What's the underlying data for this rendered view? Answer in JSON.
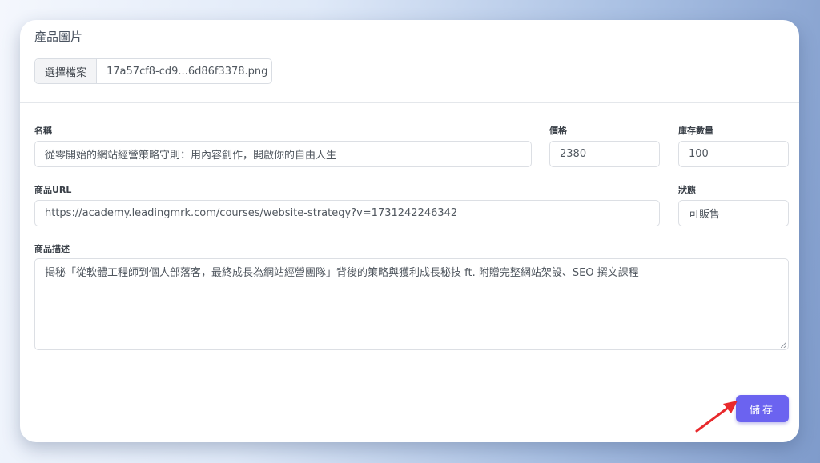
{
  "section_title": "產品圖片",
  "file_picker": {
    "button_label": "選擇檔案",
    "file_name": "17a57cf8-cd9...6d86f3378.png"
  },
  "form": {
    "name": {
      "label": "名稱",
      "value": "從零開始的網站經營策略守則：用內容創作，開啟你的自由人生"
    },
    "price": {
      "label": "價格",
      "value": "2380"
    },
    "stock": {
      "label": "庫存數量",
      "value": "100"
    },
    "url": {
      "label": "商品URL",
      "value": "https://academy.leadingmrk.com/courses/website-strategy?v=1731242246342"
    },
    "status": {
      "label": "狀態",
      "value": "可販售"
    },
    "description": {
      "label": "商品描述",
      "value": "揭秘「從軟體工程師到個人部落客，最終成長為網站經營團隊」背後的策略與獲利成長秘技 ft. 附贈完整網站架設、SEO 撰文課程"
    }
  },
  "save_label": "儲存",
  "colors": {
    "accent": "#6b63f0",
    "arrow": "#e8292c"
  },
  "icons": {
    "annotation": "red-arrow-icon"
  }
}
